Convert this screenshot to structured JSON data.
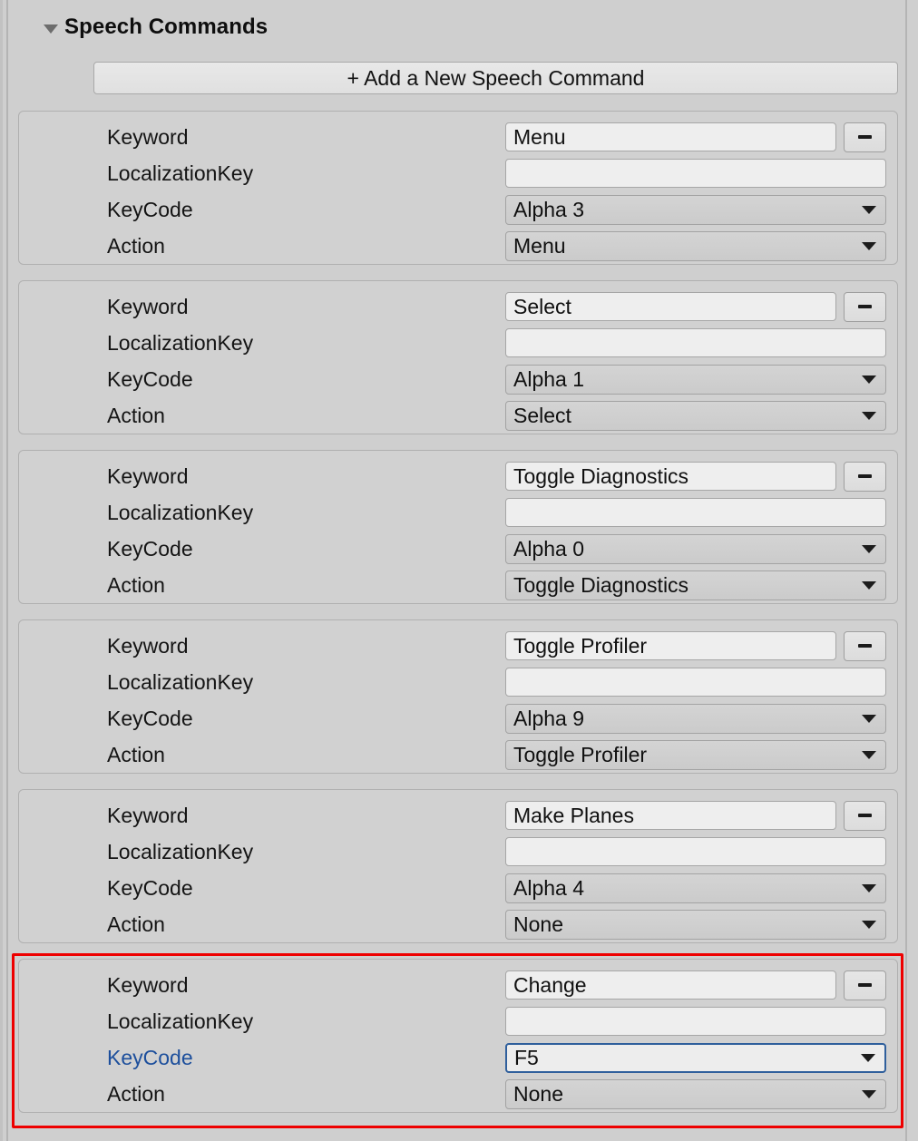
{
  "panel": {
    "accent_blue": "#1d4f9c",
    "highlight_red": "#ee0000",
    "background": "#cfcfcf"
  },
  "header": {
    "title": "Speech Commands",
    "foldout_icon": "triangle-down-icon",
    "expanded": true
  },
  "add_button": {
    "label": "+ Add a New Speech Command"
  },
  "field_labels": {
    "keyword": "Keyword",
    "localization_key": "LocalizationKey",
    "keycode": "KeyCode",
    "action": "Action"
  },
  "remove_button": {
    "label": "-",
    "icon": "minus-icon"
  },
  "dropdown_icon": "caret-down-icon",
  "localization_placeholder": "",
  "commands": [
    {
      "keyword": "Menu",
      "localization_key": "",
      "keycode": "Alpha 3",
      "action": "Menu",
      "highlighted": false,
      "keycode_focused": false
    },
    {
      "keyword": "Select",
      "localization_key": "",
      "keycode": "Alpha 1",
      "action": "Select",
      "highlighted": false,
      "keycode_focused": false
    },
    {
      "keyword": "Toggle Diagnostics",
      "localization_key": "",
      "keycode": "Alpha 0",
      "action": "Toggle Diagnostics",
      "highlighted": false,
      "keycode_focused": false
    },
    {
      "keyword": "Toggle Profiler",
      "localization_key": "",
      "keycode": "Alpha 9",
      "action": "Toggle Profiler",
      "highlighted": false,
      "keycode_focused": false
    },
    {
      "keyword": "Make Planes",
      "localization_key": "",
      "keycode": "Alpha 4",
      "action": "None",
      "highlighted": false,
      "keycode_focused": false
    },
    {
      "keyword": "Change",
      "localization_key": "",
      "keycode": "F5",
      "action": "None",
      "highlighted": true,
      "keycode_focused": true
    }
  ]
}
